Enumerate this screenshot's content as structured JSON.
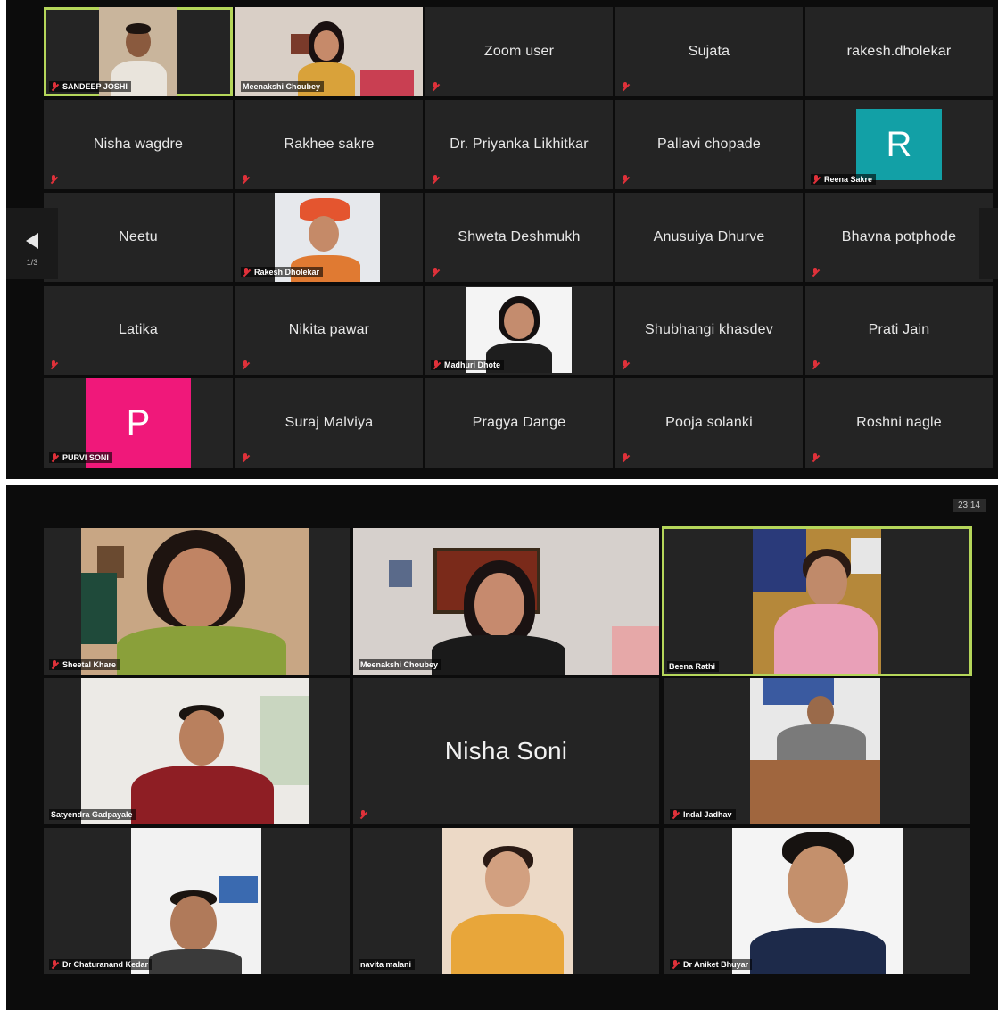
{
  "top_grid": {
    "page_indicator": "1/3",
    "tiles": [
      {
        "name": "SANDEEP JOSHI",
        "kind": "video"
      },
      {
        "name": "Meenakshi Choubey",
        "kind": "video"
      },
      {
        "name": "Zoom user",
        "kind": "text"
      },
      {
        "name": "Sujata",
        "kind": "text"
      },
      {
        "name": "rakesh.dholekar",
        "kind": "text"
      },
      {
        "name": "Nisha wagdre",
        "kind": "text"
      },
      {
        "name": "Rakhee sakre",
        "kind": "text"
      },
      {
        "name": "Dr. Priyanka Likhitkar",
        "kind": "text"
      },
      {
        "name": "Pallavi chopade",
        "kind": "text"
      },
      {
        "name": "Reena Sakre",
        "kind": "avatar",
        "letter": "R",
        "color": "#12a0a6"
      },
      {
        "name": "Neetu",
        "kind": "text"
      },
      {
        "name": "Rakesh Dholekar",
        "kind": "video"
      },
      {
        "name": "Shweta Deshmukh",
        "kind": "text"
      },
      {
        "name": "Anusuiya Dhurve",
        "kind": "text"
      },
      {
        "name": "Bhavna potphode",
        "kind": "text"
      },
      {
        "name": "Latika",
        "kind": "text"
      },
      {
        "name": "Nikita pawar",
        "kind": "text"
      },
      {
        "name": "Madhuri Dhote",
        "kind": "video"
      },
      {
        "name": "Shubhangi khasdev",
        "kind": "text"
      },
      {
        "name": "Prati Jain",
        "kind": "text"
      },
      {
        "name": "PURVI SONI",
        "kind": "avatar",
        "letter": "P",
        "color": "#f0187a"
      },
      {
        "name": "Suraj Malviya",
        "kind": "text"
      },
      {
        "name": "Pragya Dange",
        "kind": "text"
      },
      {
        "name": "Pooja solanki",
        "kind": "text"
      },
      {
        "name": "Roshni nagle",
        "kind": "text"
      }
    ]
  },
  "bottom_grid": {
    "time": "23:14",
    "tiles": [
      {
        "name": "Sheetal Khare"
      },
      {
        "name": "Meenakshi Choubey"
      },
      {
        "name": "Beena Rathi"
      },
      {
        "name": "Satyendra Gadpayale"
      },
      {
        "name": "Nisha Soni"
      },
      {
        "name": "Indal Jadhav"
      },
      {
        "name": "Dr Chaturanand Kedar"
      },
      {
        "name": "navita malani"
      },
      {
        "name": "Dr Aniket Bhuyar"
      }
    ]
  },
  "colors": {
    "active_speaker_border": "#b5d65a",
    "muted_icon": "#e0313a",
    "tile_bg": "#242424"
  }
}
